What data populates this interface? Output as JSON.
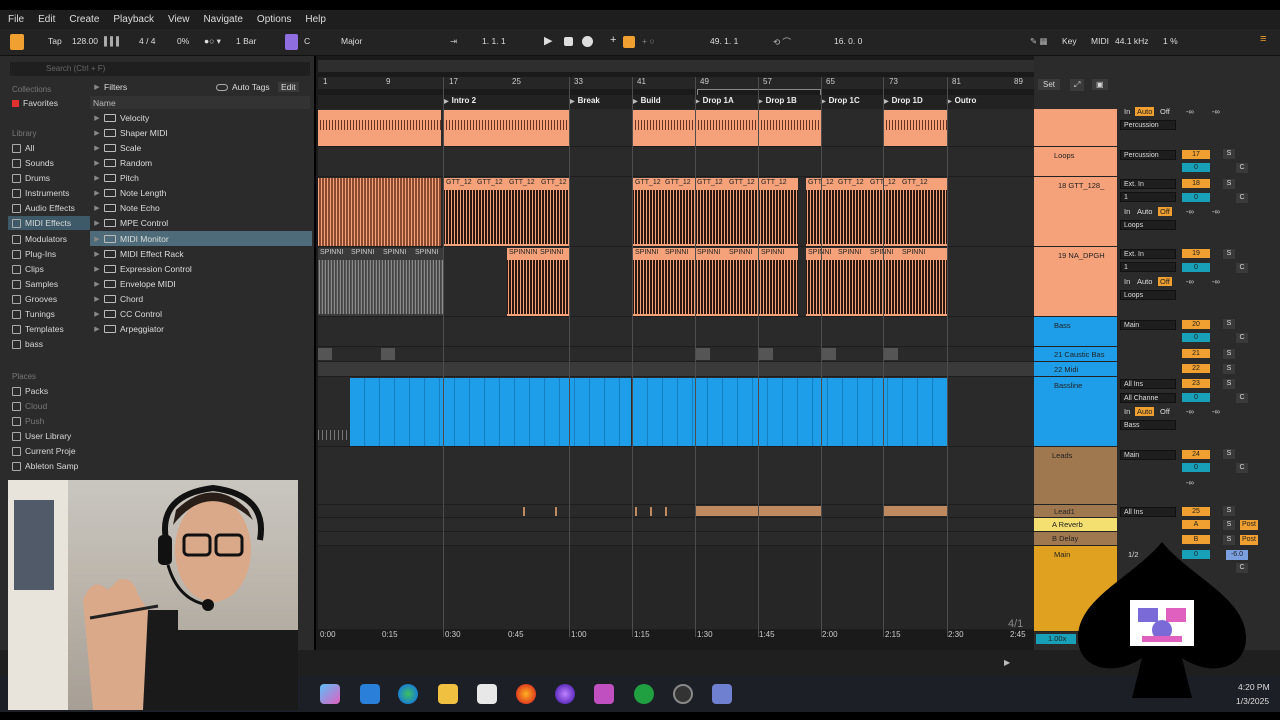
{
  "menu": [
    "File",
    "Edit",
    "Create",
    "Playback",
    "View",
    "Navigate",
    "Options",
    "Help"
  ],
  "transport": {
    "tap": "Tap",
    "tempo": "128.00",
    "signature": "4 / 4",
    "groove": "0%",
    "quantize": "1 Bar",
    "key": "C",
    "scale": "Major",
    "position": "1.   1.   1",
    "loop_start": "49.   1.   1",
    "loop_length": "16.   0.   0",
    "key_label": "Key",
    "midi_label": "MIDI",
    "sample_rate": "44.1 kHz",
    "cpu": "1 %"
  },
  "browser": {
    "search_placeholder": "Search (Ctrl + F)",
    "filters": "Filters",
    "auto_tags": "Auto Tags",
    "edit": "Edit",
    "name_header": "Name",
    "collections_head": "Collections",
    "favorites": "Favorites",
    "library_head": "Library",
    "library": [
      "All",
      "Sounds",
      "Drums",
      "Instruments",
      "Audio Effects",
      "MIDI Effects",
      "Modulators",
      "Plug-Ins",
      "Clips",
      "Samples",
      "Grooves",
      "Tunings",
      "Templates",
      "bass"
    ],
    "places_head": "Places",
    "places": [
      "Packs",
      "Cloud",
      "Push",
      "User Library",
      "Current Proje",
      "Ableton Samp"
    ],
    "items": [
      "Velocity",
      "Shaper MIDI",
      "Scale",
      "Random",
      "Pitch",
      "Note Length",
      "Note Echo",
      "MPE Control",
      "MIDI Monitor",
      "MIDI Effect Rack",
      "Expression Control",
      "Envelope MIDI",
      "Chord",
      "CC Control",
      "Arpeggiator"
    ]
  },
  "ruler": [
    "1",
    "9",
    "17",
    "25",
    "33",
    "41",
    "49",
    "57",
    "65",
    "73",
    "81",
    "89"
  ],
  "locators": [
    "Intro 2",
    "Break",
    "Build",
    "Drop 1A",
    "Drop 1B",
    "Drop 1C",
    "Drop 1D",
    "Outro"
  ],
  "clips": {
    "gtt": "GTT_12",
    "spin": "SPINNI",
    "spin2": "SPINNIN"
  },
  "timeline": [
    "0:00",
    "0:15",
    "0:30",
    "0:45",
    "1:00",
    "1:15",
    "1:30",
    "1:45",
    "2:00",
    "2:15",
    "2:30",
    "2:45"
  ],
  "page_indicator": "4/1",
  "set_btn": "Set",
  "zoom": "1.00x",
  "tracks": {
    "t_loops": "Loops",
    "t18": "18 GTT_128_",
    "t19": "19 NA_DPGH",
    "t_bass": "Bass",
    "t21": "21 Caustic Bas",
    "t22": "22 Midi",
    "t_bassline": "Bassline",
    "t_leads": "Leads",
    "t_lead1": "Lead1",
    "t_reverb": "A Reverb",
    "t_delay": "B Delay",
    "t_main": "Main"
  },
  "mixer": {
    "in": "In",
    "auto": "Auto",
    "off": "Off",
    "percussion": "Percussion",
    "ext_in": "Ext. In",
    "one": "1",
    "loops": "Loops",
    "main": "Main",
    "all_ins": "All Ins",
    "all_channels": "All Channe",
    "bass": "Bass",
    "inf": "-∞",
    "n17": "17",
    "n18": "18",
    "n19": "19",
    "n20": "20",
    "n21": "21",
    "n22": "22",
    "n23": "23",
    "n24": "24",
    "n25": "25",
    "zero": "0",
    "a": "A",
    "b": "B",
    "s": "S",
    "c": "C",
    "post": "Post",
    "half": "1/2",
    "minus6": "-6.0"
  },
  "taskbar": {
    "time": "4:20 PM",
    "date": "1/3/2025"
  }
}
